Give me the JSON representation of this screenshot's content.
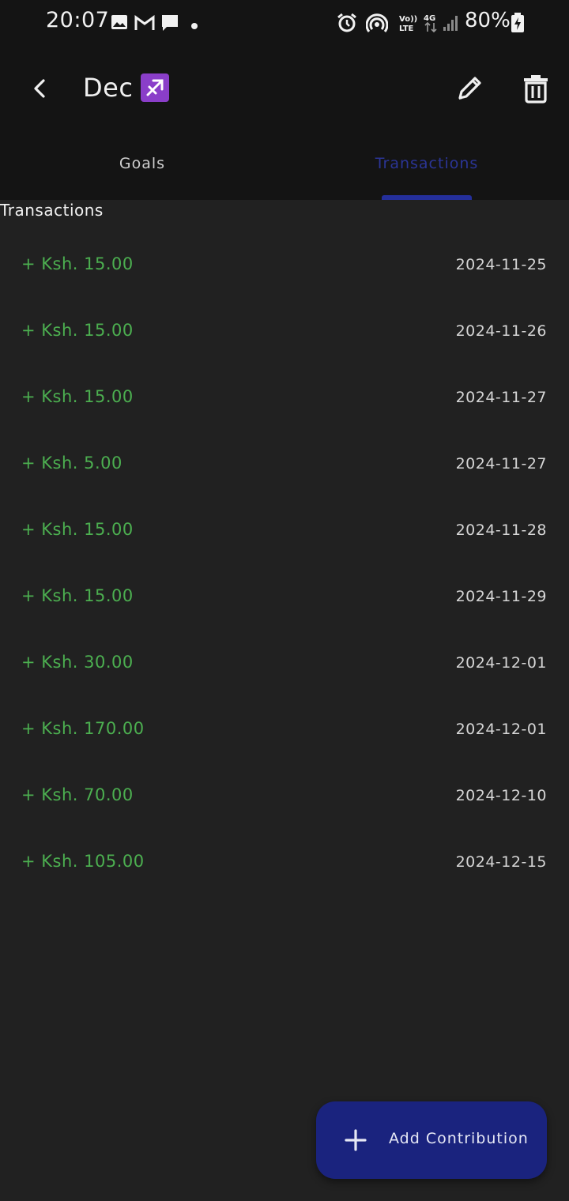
{
  "status_bar": {
    "time": "20:07",
    "battery_text": "80%",
    "left_icons": [
      "image-icon",
      "gmail-icon",
      "chat-bubble-icon",
      "dot-icon"
    ],
    "right_icons": [
      "alarm-icon",
      "hotspot-icon",
      "volte-icon",
      "4g-data-icon",
      "signal-icon",
      "battery-charging-icon"
    ]
  },
  "app_bar": {
    "title": "Dec",
    "title_emoji": "♐",
    "back_icon": "back-arrow-icon",
    "edit_icon": "pencil-icon",
    "delete_icon": "trash-icon"
  },
  "tabs": [
    {
      "label": "Goals",
      "active": false
    },
    {
      "label": "Transactions",
      "active": true
    }
  ],
  "section": {
    "heading": "Transactions"
  },
  "transactions": [
    {
      "amount": "+ Ksh. 15.00",
      "date": "2024-11-25"
    },
    {
      "amount": "+ Ksh. 15.00",
      "date": "2024-11-26"
    },
    {
      "amount": "+ Ksh. 15.00",
      "date": "2024-11-27"
    },
    {
      "amount": "+ Ksh. 5.00",
      "date": "2024-11-27"
    },
    {
      "amount": "+ Ksh. 15.00",
      "date": "2024-11-28"
    },
    {
      "amount": "+ Ksh. 15.00",
      "date": "2024-11-29"
    },
    {
      "amount": "+ Ksh. 30.00",
      "date": "2024-12-01"
    },
    {
      "amount": "+ Ksh. 170.00",
      "date": "2024-12-01"
    },
    {
      "amount": "+ Ksh. 70.00",
      "date": "2024-12-10"
    },
    {
      "amount": "+ Ksh. 105.00",
      "date": "2024-12-15"
    }
  ],
  "fab": {
    "label": "Add Contribution",
    "icon": "plus-icon"
  },
  "colors": {
    "background": "#212121",
    "header": "#141414",
    "amount_green": "#4caf50",
    "accent": "#1a237e"
  }
}
